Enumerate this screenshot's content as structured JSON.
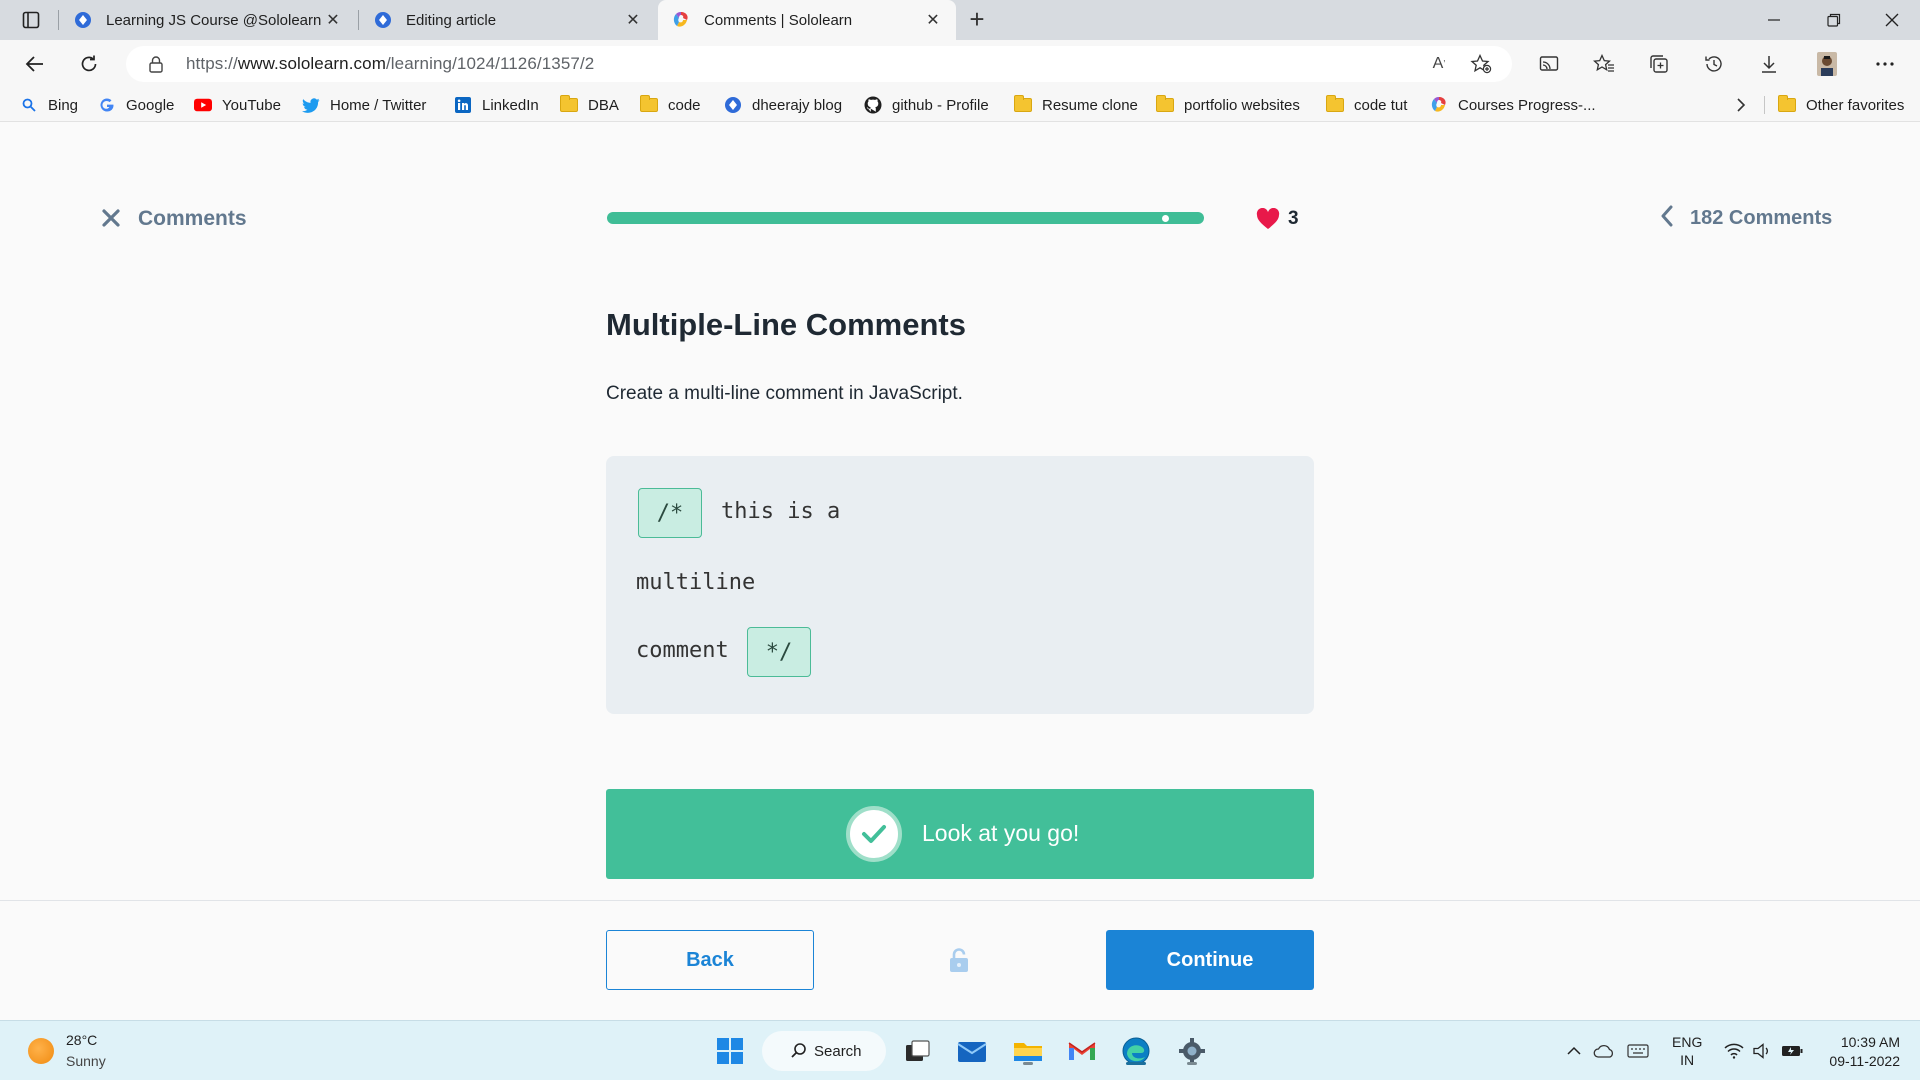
{
  "browser": {
    "tabs": [
      {
        "title": "Learning JS Course @Sololearn -",
        "active": false
      },
      {
        "title": "Editing article",
        "active": false
      },
      {
        "title": "Comments | Sololearn",
        "active": true
      }
    ],
    "new_tab_label": "+",
    "url_prefix": "https://",
    "url_host": "www.sololearn.com",
    "url_path": "/learning/1024/1126/1357/2",
    "favorites": [
      {
        "label": "Bing",
        "icon": "search-icon"
      },
      {
        "label": "Google",
        "icon": "google-icon"
      },
      {
        "label": "YouTube",
        "icon": "youtube-icon"
      },
      {
        "label": "Home / Twitter",
        "icon": "twitter-icon"
      },
      {
        "label": "LinkedIn",
        "icon": "linkedin-icon"
      },
      {
        "label": "DBA",
        "icon": "folder-icon"
      },
      {
        "label": "code",
        "icon": "folder-icon"
      },
      {
        "label": "dheerajy blog",
        "icon": "blog-icon"
      },
      {
        "label": "github - Profile",
        "icon": "github-icon"
      },
      {
        "label": "Resume clone",
        "icon": "folder-icon"
      },
      {
        "label": "portfolio websites",
        "icon": "folder-icon"
      },
      {
        "label": "code tut",
        "icon": "folder-icon"
      },
      {
        "label": "Courses Progress-...",
        "icon": "sololearn-icon"
      }
    ],
    "other_favorites": "Other favorites"
  },
  "lesson": {
    "close_label": "Comments",
    "progress_fraction": 0.94,
    "lives": "3",
    "comments_count_label": "182 Comments",
    "title": "Multiple-Line Comments",
    "description": "Create a multi-line comment in JavaScript.",
    "code": {
      "open_token": "/*",
      "line1_text": "this is a",
      "line2_text": "multiline",
      "line3_text": "comment",
      "close_token": "*/"
    },
    "success_message": "Look at you go!",
    "back_label": "Back",
    "continue_label": "Continue"
  },
  "taskbar": {
    "weather_temp": "28°C",
    "weather_condition": "Sunny",
    "search_label": "Search",
    "language_line1": "ENG",
    "language_line2": "IN",
    "time": "10:39 AM",
    "date": "09-11-2022"
  },
  "colors": {
    "accent_green": "#42bf99",
    "accent_blue": "#1b84d6",
    "heart_red": "#e8194a",
    "muted_slate": "#62788e"
  }
}
